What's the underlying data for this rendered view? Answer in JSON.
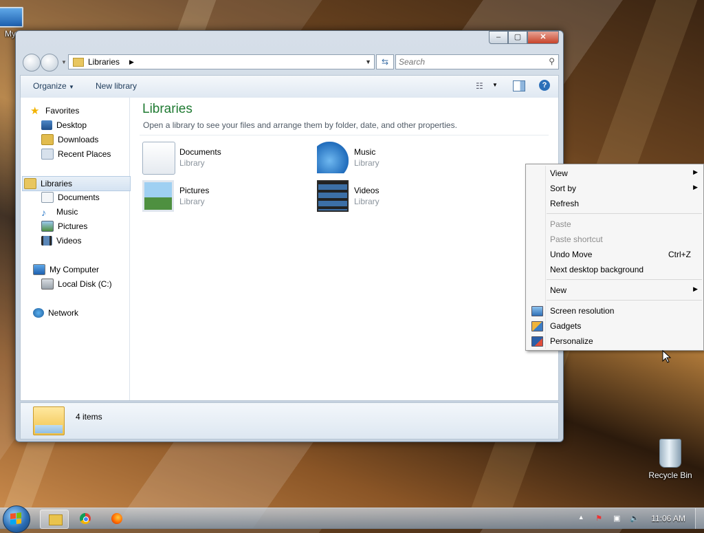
{
  "desktop": {
    "icons": [
      {
        "label": "My"
      },
      {
        "label": "Recycle Bin"
      }
    ]
  },
  "window": {
    "address": {
      "crumb": "Libraries",
      "search_placeholder": "Search"
    },
    "toolbar": {
      "organize": "Organize",
      "new_library": "New library"
    },
    "nav": {
      "favorites": "Favorites",
      "favorites_items": [
        "Desktop",
        "Downloads",
        "Recent Places"
      ],
      "libraries": "Libraries",
      "libraries_items": [
        "Documents",
        "Music",
        "Pictures",
        "Videos"
      ],
      "computer": "My Computer",
      "computer_items": [
        "Local Disk (C:)"
      ],
      "network": "Network"
    },
    "main": {
      "title": "Libraries",
      "subtitle": "Open a library to see your files and arrange them by folder, date, and other properties.",
      "items": [
        {
          "name": "Documents",
          "type": "Library",
          "icon": "documents-library-icon"
        },
        {
          "name": "Music",
          "type": "Library",
          "icon": "music-library-icon"
        },
        {
          "name": "Pictures",
          "type": "Library",
          "icon": "pictures-library-icon"
        },
        {
          "name": "Videos",
          "type": "Library",
          "icon": "videos-library-icon"
        }
      ]
    },
    "status": {
      "count": "4 items"
    }
  },
  "context_menu": {
    "items": [
      {
        "label": "View",
        "submenu": true
      },
      {
        "label": "Sort by",
        "submenu": true
      },
      {
        "label": "Refresh"
      },
      {
        "label": "Paste",
        "disabled": true
      },
      {
        "label": "Paste shortcut",
        "disabled": true
      },
      {
        "label": "Undo Move",
        "shortcut": "Ctrl+Z"
      },
      {
        "label": "Next desktop background"
      },
      {
        "label": "New",
        "submenu": true
      },
      {
        "label": "Screen resolution",
        "icon": "screen-resolution-icon"
      },
      {
        "label": "Gadgets",
        "icon": "gadgets-icon"
      },
      {
        "label": "Personalize",
        "icon": "personalize-icon"
      }
    ]
  },
  "taskbar": {
    "clock": "11:06 AM"
  },
  "colors": {
    "library_title": "#1f7a32",
    "selection": "#d5e3f2"
  }
}
